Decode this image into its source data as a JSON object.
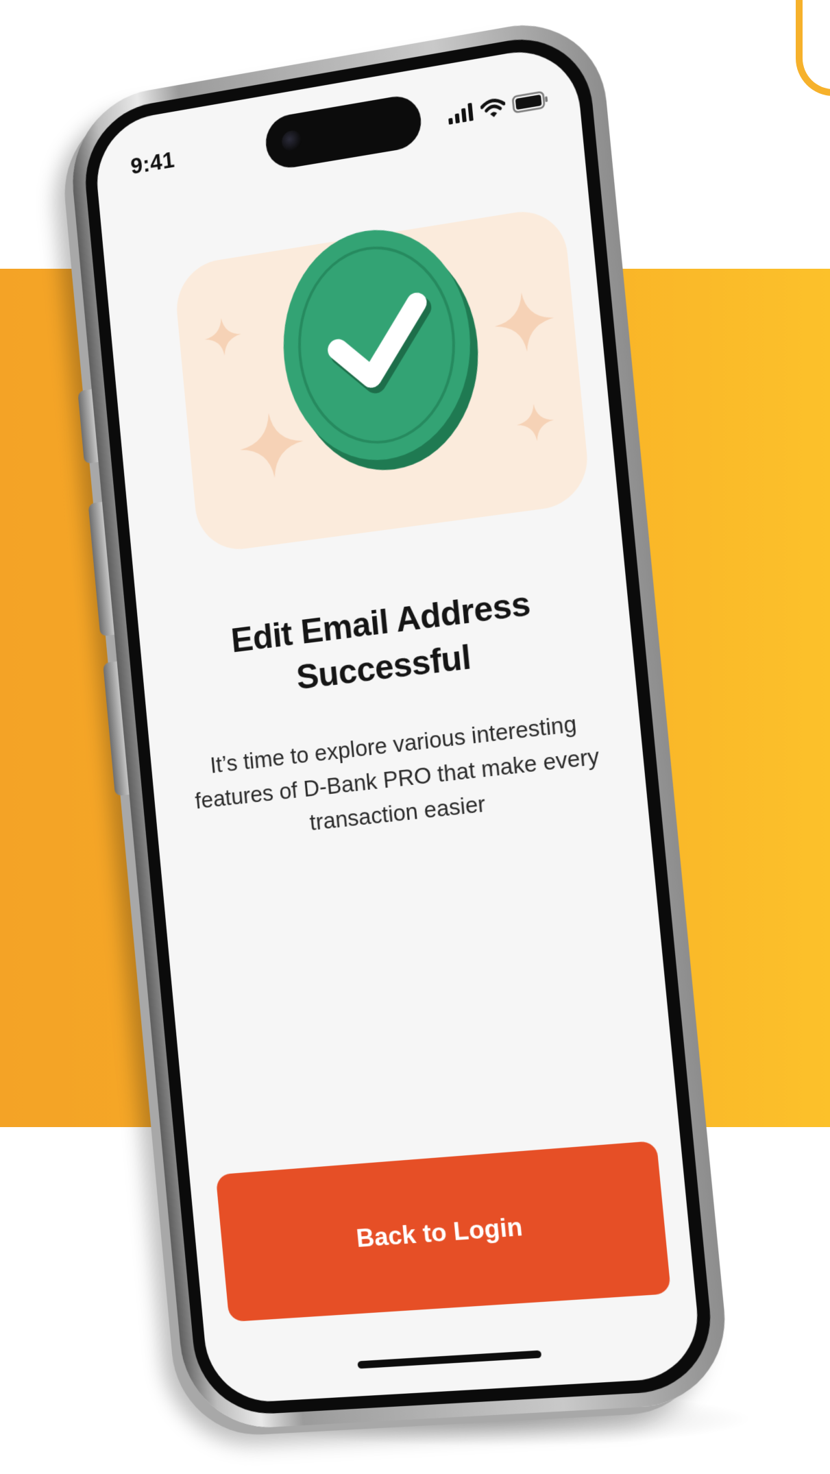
{
  "status_bar": {
    "time": "9:41"
  },
  "success": {
    "title_line1": "Edit Email Address",
    "title_line2": "Successful",
    "description": "It’s time to explore various interesting features of D-Bank PRO that make every transaction easier"
  },
  "actions": {
    "back_to_login_label": "Back to Login"
  },
  "icons": {
    "hero": "checkmark-coin-icon",
    "signal": "cellular-signal-icon",
    "wifi": "wifi-icon",
    "battery": "battery-icon"
  },
  "colors": {
    "background_accent": "#f7ad27",
    "primary_button": "#e64f26",
    "success_green": "#33a374",
    "hero_backdrop": "#fbebdc",
    "sparkle": "#f6d2b6",
    "screen_background": "#f6f6f6"
  }
}
